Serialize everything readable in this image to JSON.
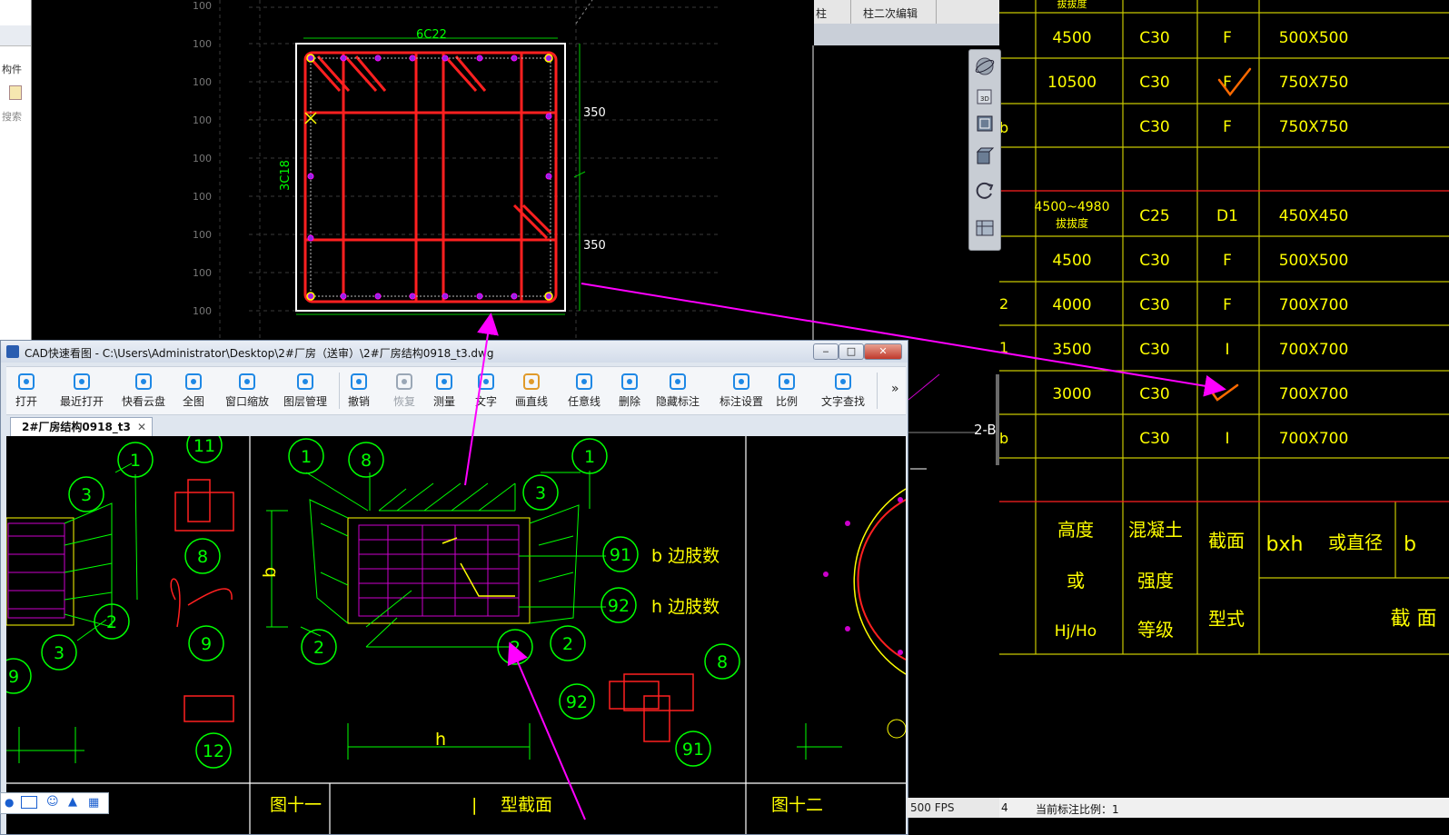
{
  "window": {
    "title": "CAD快速看图 - C:\\Users\\Administrator\\Desktop\\2#厂房（送审）\\2#厂房结构0918_t3.dwg",
    "doc_tab": "2#厂房结构0918_t3",
    "close_glyph": "✕"
  },
  "left_panel": {
    "labels": [
      "构件",
      "搜索"
    ]
  },
  "top_tabs": {
    "tab1": "柱",
    "tab2": "柱二次编辑"
  },
  "toolbar": [
    {
      "label": "打开",
      "icon": "folder-icon"
    },
    {
      "label": "最近打开",
      "icon": "clock-icon"
    },
    {
      "label": "快看云盘",
      "icon": "cloud-icon"
    },
    {
      "label": "全图",
      "icon": "fullview-icon"
    },
    {
      "label": "窗口缩放",
      "icon": "window-zoom-icon"
    },
    {
      "label": "图层管理",
      "icon": "layers-icon"
    },
    {
      "label": "撤销",
      "icon": "undo-icon"
    },
    {
      "label": "恢复",
      "icon": "redo-icon"
    },
    {
      "label": "测量",
      "icon": "measure-icon"
    },
    {
      "label": "文字",
      "icon": "text-icon"
    },
    {
      "label": "画直线",
      "icon": "line-icon"
    },
    {
      "label": "任意线",
      "icon": "pen-icon"
    },
    {
      "label": "删除",
      "icon": "eraser-icon"
    },
    {
      "label": "隐藏标注",
      "icon": "eye-hide-icon"
    },
    {
      "label": "标注设置",
      "icon": "annotation-settings-icon"
    },
    {
      "label": "比例",
      "icon": "scale-icon"
    },
    {
      "label": "文字查找",
      "icon": "text-search-icon"
    }
  ],
  "toolbar_more": "»",
  "cad_top": {
    "rebar_top": "6C22",
    "rebar_side": "3C18",
    "dim_upper": "350",
    "dim_lower": "350",
    "grid_label": "100"
  },
  "table": {
    "header_top": "拔拔度",
    "rows": [
      {
        "height": "4500",
        "grade": "C30",
        "type": "F",
        "section": "500X500"
      },
      {
        "height": "10500",
        "grade": "C30",
        "type": "F",
        "section": "750X750"
      },
      {
        "height": "",
        "grade": "C30",
        "type": "F",
        "section": "750X750"
      },
      {
        "height": "4500~4980",
        "height_note": "拔拔度",
        "grade": "C25",
        "type": "D1",
        "section": "450X450"
      },
      {
        "height": "4500",
        "grade": "C30",
        "type": "F",
        "section": "500X500"
      },
      {
        "height": "4000",
        "grade": "C30",
        "type": "F",
        "section": "700X700"
      },
      {
        "height": "3500",
        "grade": "C30",
        "type": "I",
        "section": "700X700"
      },
      {
        "height": "3000",
        "grade": "C30",
        "type": "",
        "section": "700X700"
      },
      {
        "height": "",
        "grade": "C30",
        "type": "I",
        "section": "700X700"
      }
    ],
    "left_marks": [
      "b",
      "2",
      "1",
      "b"
    ],
    "col_headers": {
      "height": [
        "高度",
        "或",
        "Hj/Ho"
      ],
      "concrete": [
        "混凝土",
        "强度",
        "等级"
      ],
      "section_type": [
        "截面",
        "型式"
      ],
      "bxh": "bxh",
      "diameter": "或直径",
      "b": "b",
      "section": "截 面"
    }
  },
  "canvas": {
    "bubbles": [
      "11",
      "1",
      "3",
      "8",
      "9",
      "3",
      "2",
      "9",
      "12",
      "1",
      "8",
      "3",
      "1",
      "91",
      "92",
      "2",
      "2",
      "2",
      "8",
      "92",
      "91"
    ],
    "labels": {
      "b_limbs": "b 边肢数",
      "h_limbs": "h 边肢数",
      "dim_b": "b",
      "dim_h": "h"
    },
    "bottom": {
      "fig11": "图十一",
      "section": "型截面",
      "fig12": "图十二",
      "divider": "|"
    }
  },
  "marker_2B": "2-B",
  "status": {
    "fps": "500 FPS",
    "scale_label": "当前标注比例：1",
    "left_num": "4"
  },
  "colors": {
    "yellow": "#ffff00",
    "red": "#ff2020",
    "green": "#00ff00",
    "magenta": "#ff00ff",
    "white": "#ffffff",
    "orange_check": "#ff6a00"
  }
}
